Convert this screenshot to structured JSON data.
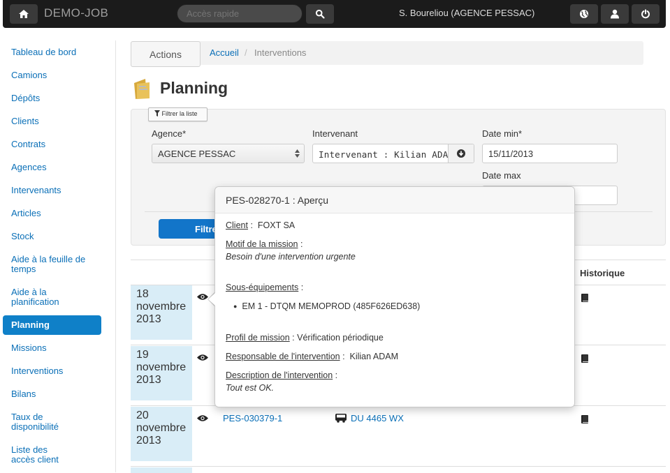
{
  "navbar": {
    "brand": "DEMO-JOB",
    "search_placeholder": "Accès rapide",
    "user": "S. Boureliou (AGENCE PESSAC)"
  },
  "sidebar": {
    "items": [
      {
        "label": "Tableau de bord"
      },
      {
        "label": "Camions"
      },
      {
        "label": "Dépôts"
      },
      {
        "label": "Clients"
      },
      {
        "label": "Contrats"
      },
      {
        "label": "Agences"
      },
      {
        "label": "Intervenants"
      },
      {
        "label": "Articles"
      },
      {
        "label": "Stock"
      },
      {
        "label": "Aide à la feuille de temps"
      },
      {
        "label": "Aide à la planification"
      },
      {
        "label": "Planning"
      },
      {
        "label": "Missions"
      },
      {
        "label": "Interventions"
      },
      {
        "label": "Bilans"
      },
      {
        "label": "Taux de disponibilité"
      },
      {
        "label": "Liste des accès client"
      }
    ],
    "active": "Planning"
  },
  "breadcrumb": {
    "actions": "Actions",
    "home": "Accueil",
    "separator": "/",
    "current": "Interventions"
  },
  "page": {
    "title": "Planning"
  },
  "filter": {
    "toggle_label": "Filtrer la liste",
    "agence_label": "Agence*",
    "agence_value": "AGENCE PESSAC",
    "intervenant_label": "Intervenant",
    "intervenant_value": "Intervenant : Kilian ADAM",
    "date_min_label": "Date min*",
    "date_min_value": "15/11/2013",
    "date_max_label": "Date max",
    "date_max_value": "",
    "submit_label": "Filtrer"
  },
  "table": {
    "history_header": "Historique",
    "rows": [
      {
        "date": "18 novembre 2013"
      },
      {
        "date": "19 novembre 2013"
      },
      {
        "date": "20 novembre 2013",
        "reference": "PES-030379-1",
        "truck": "DU 4465 WX"
      }
    ]
  },
  "popover": {
    "title": "PES-028270-1 : Aperçu",
    "client_label": "Client",
    "client_value": "FOXT SA",
    "motif_label": "Motif de la mission",
    "motif_value": "Besoin d'une intervention urgente",
    "sous_label": "Sous-équipements",
    "sous_items": [
      "EM 1 - DTQM MEMOPROD (485F626ED638)"
    ],
    "profil_label": "Profil de mission",
    "profil_value": "Vérification périodique",
    "responsable_label": "Responsable de l'intervention",
    "responsable_value": "Kilian ADAM",
    "description_label": "Description de l'intervention",
    "description_value": "Tout est OK."
  },
  "colors": {
    "link": "#0a6fb7",
    "active": "#0f80c8",
    "navbar": "#1b1b1b",
    "date_cell": "#d9edf7"
  }
}
